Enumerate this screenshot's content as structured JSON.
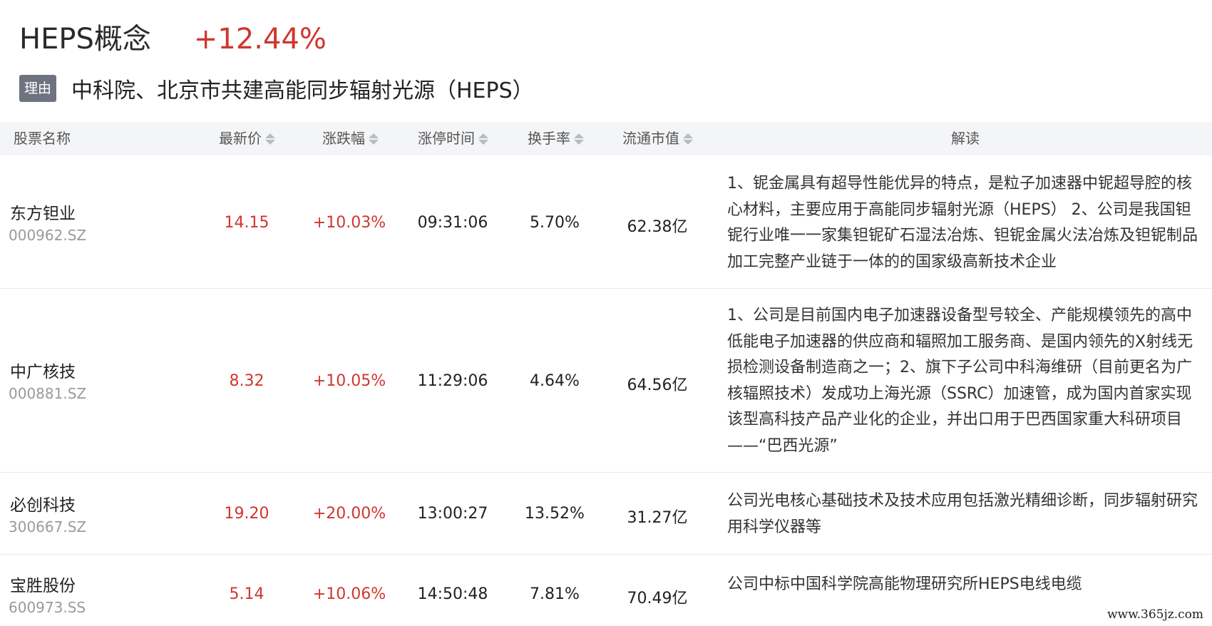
{
  "header": {
    "concept_name": "HEPS概念",
    "concept_change": "+12.44%",
    "reason_badge": "理由",
    "reason_text": "中科院、北京市共建高能同步辐射光源（HEPS）"
  },
  "table": {
    "columns": {
      "name": "股票名称",
      "price": "最新价",
      "change": "涨跌幅",
      "limit_time": "涨停时间",
      "turnover": "换手率",
      "float_cap": "流通市值",
      "desc": "解读"
    },
    "rows": [
      {
        "name": "东方钽业",
        "code": "000962.SZ",
        "price": "14.15",
        "change": "+10.03%",
        "limit_time": "09:31:06",
        "turnover": "5.70%",
        "float_cap": "62.38亿",
        "desc": "1、铌金属具有超导性能优异的特点，是粒子加速器中铌超导腔的核心材料，主要应用于高能同步辐射光源（HEPS） 2、公司是我国钽铌行业唯一一家集钽铌矿石湿法冶炼、钽铌金属火法冶炼及钽铌制品加工完整产业链于一体的的国家级高新技术企业"
      },
      {
        "name": "中广核技",
        "code": "000881.SZ",
        "price": "8.32",
        "change": "+10.05%",
        "limit_time": "11:29:06",
        "turnover": "4.64%",
        "float_cap": "64.56亿",
        "desc": "1、公司是目前国内电子加速器设备型号较全、产能规模领先的高中低能电子加速器的供应商和辐照加工服务商、是国内领先的X射线无损检测设备制造商之一；2、旗下子公司中科海维研（目前更名为广核辐照技术）发成功上海光源（SSRC）加速管，成为国内首家实现该型高科技产品产业化的企业，并出口用于巴西国家重大科研项目——“巴西光源”"
      },
      {
        "name": "必创科技",
        "code": "300667.SZ",
        "price": "19.20",
        "change": "+20.00%",
        "limit_time": "13:00:27",
        "turnover": "13.52%",
        "float_cap": "31.27亿",
        "desc": "公司光电核心基础技术及技术应用包括激光精细诊断，同步辐射研究用科学仪器等"
      },
      {
        "name": "宝胜股份",
        "code": "600973.SS",
        "price": "5.14",
        "change": "+10.06%",
        "limit_time": "14:50:48",
        "turnover": "7.81%",
        "float_cap": "70.49亿",
        "desc": "公司中标中国科学院高能物理研究所HEPS电线电缆"
      }
    ]
  },
  "watermark": "www.365jz.com",
  "colors": {
    "up": "#d0362f",
    "badge": "#6f7380",
    "header_bg": "#f4f5f7"
  }
}
